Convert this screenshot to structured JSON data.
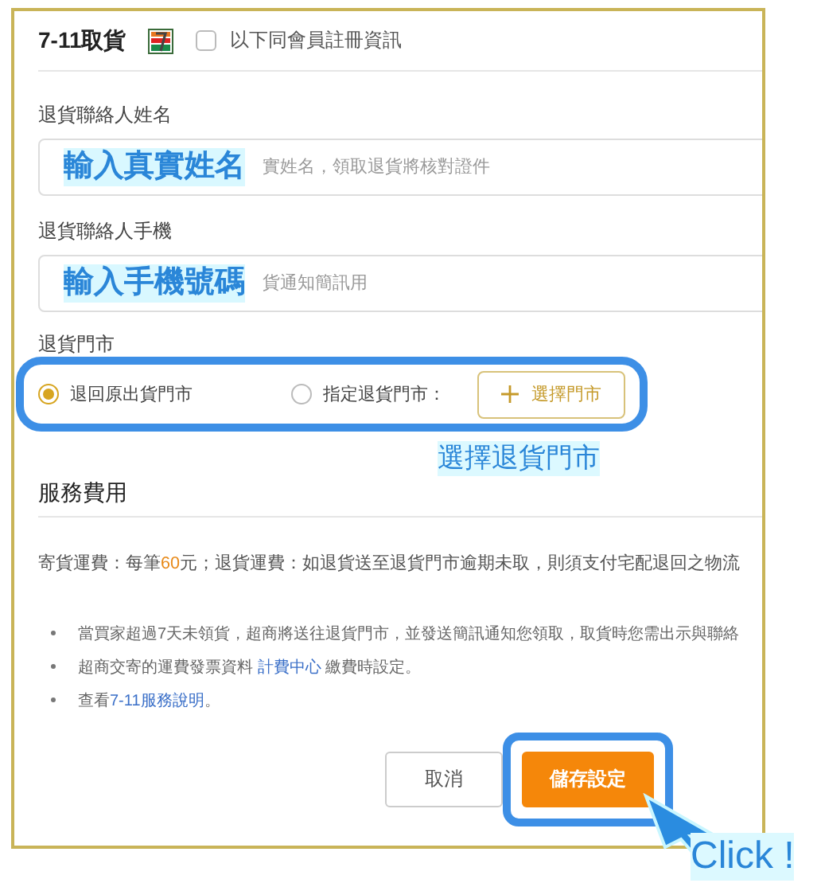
{
  "header": {
    "title": "7-11取貨",
    "same_as_member": {
      "label": "以下同會員註冊資訊",
      "checked": false
    }
  },
  "fields": [
    {
      "label": "退貨聯絡人姓名",
      "placeholder": "實姓名，領取退貨將核對證件",
      "annotation": "輸入真實姓名"
    },
    {
      "label": "退貨聯絡人手機",
      "placeholder": "貨通知簡訊用",
      "annotation": "輸入手機號碼"
    }
  ],
  "return_store": {
    "label": "退貨門市",
    "highlighted": true,
    "options": [
      {
        "label": "退回原出貨門市",
        "selected": true
      },
      {
        "label": "指定退貨門市：",
        "selected": false
      }
    ],
    "select_button": "選擇門市",
    "annotation": "選擇退貨門市"
  },
  "service_fee": {
    "title": "服務費用",
    "fee_text": [
      {
        "kind": "text",
        "text": "寄貨運費：每筆"
      },
      {
        "kind": "highlight",
        "text": "60"
      },
      {
        "kind": "text",
        "text": "元；退貨運費：如退貨送至退貨門市逾期未取，則須支付宅配退回之物流"
      }
    ],
    "notes": [
      [
        {
          "kind": "text",
          "text": "當買家超過7天未領貨，超商將送往退貨門市，並發送簡訊通知您領取，取貨時您需出示與聯絡"
        }
      ],
      [
        {
          "kind": "text",
          "text": "超商交寄的運費發票資料 "
        },
        {
          "kind": "link",
          "text": "計費中心"
        },
        {
          "kind": "text",
          "text": " 繳費時設定。"
        }
      ],
      [
        {
          "kind": "text",
          "text": "查看"
        },
        {
          "kind": "link",
          "text": "7-11服務說明"
        },
        {
          "kind": "text",
          "text": "。"
        }
      ]
    ]
  },
  "buttons": [
    {
      "label": "取消",
      "kind": "secondary",
      "highlighted": false
    },
    {
      "label": "儲存設定",
      "kind": "primary",
      "highlighted": true
    }
  ],
  "click_annotation": "Click !"
}
